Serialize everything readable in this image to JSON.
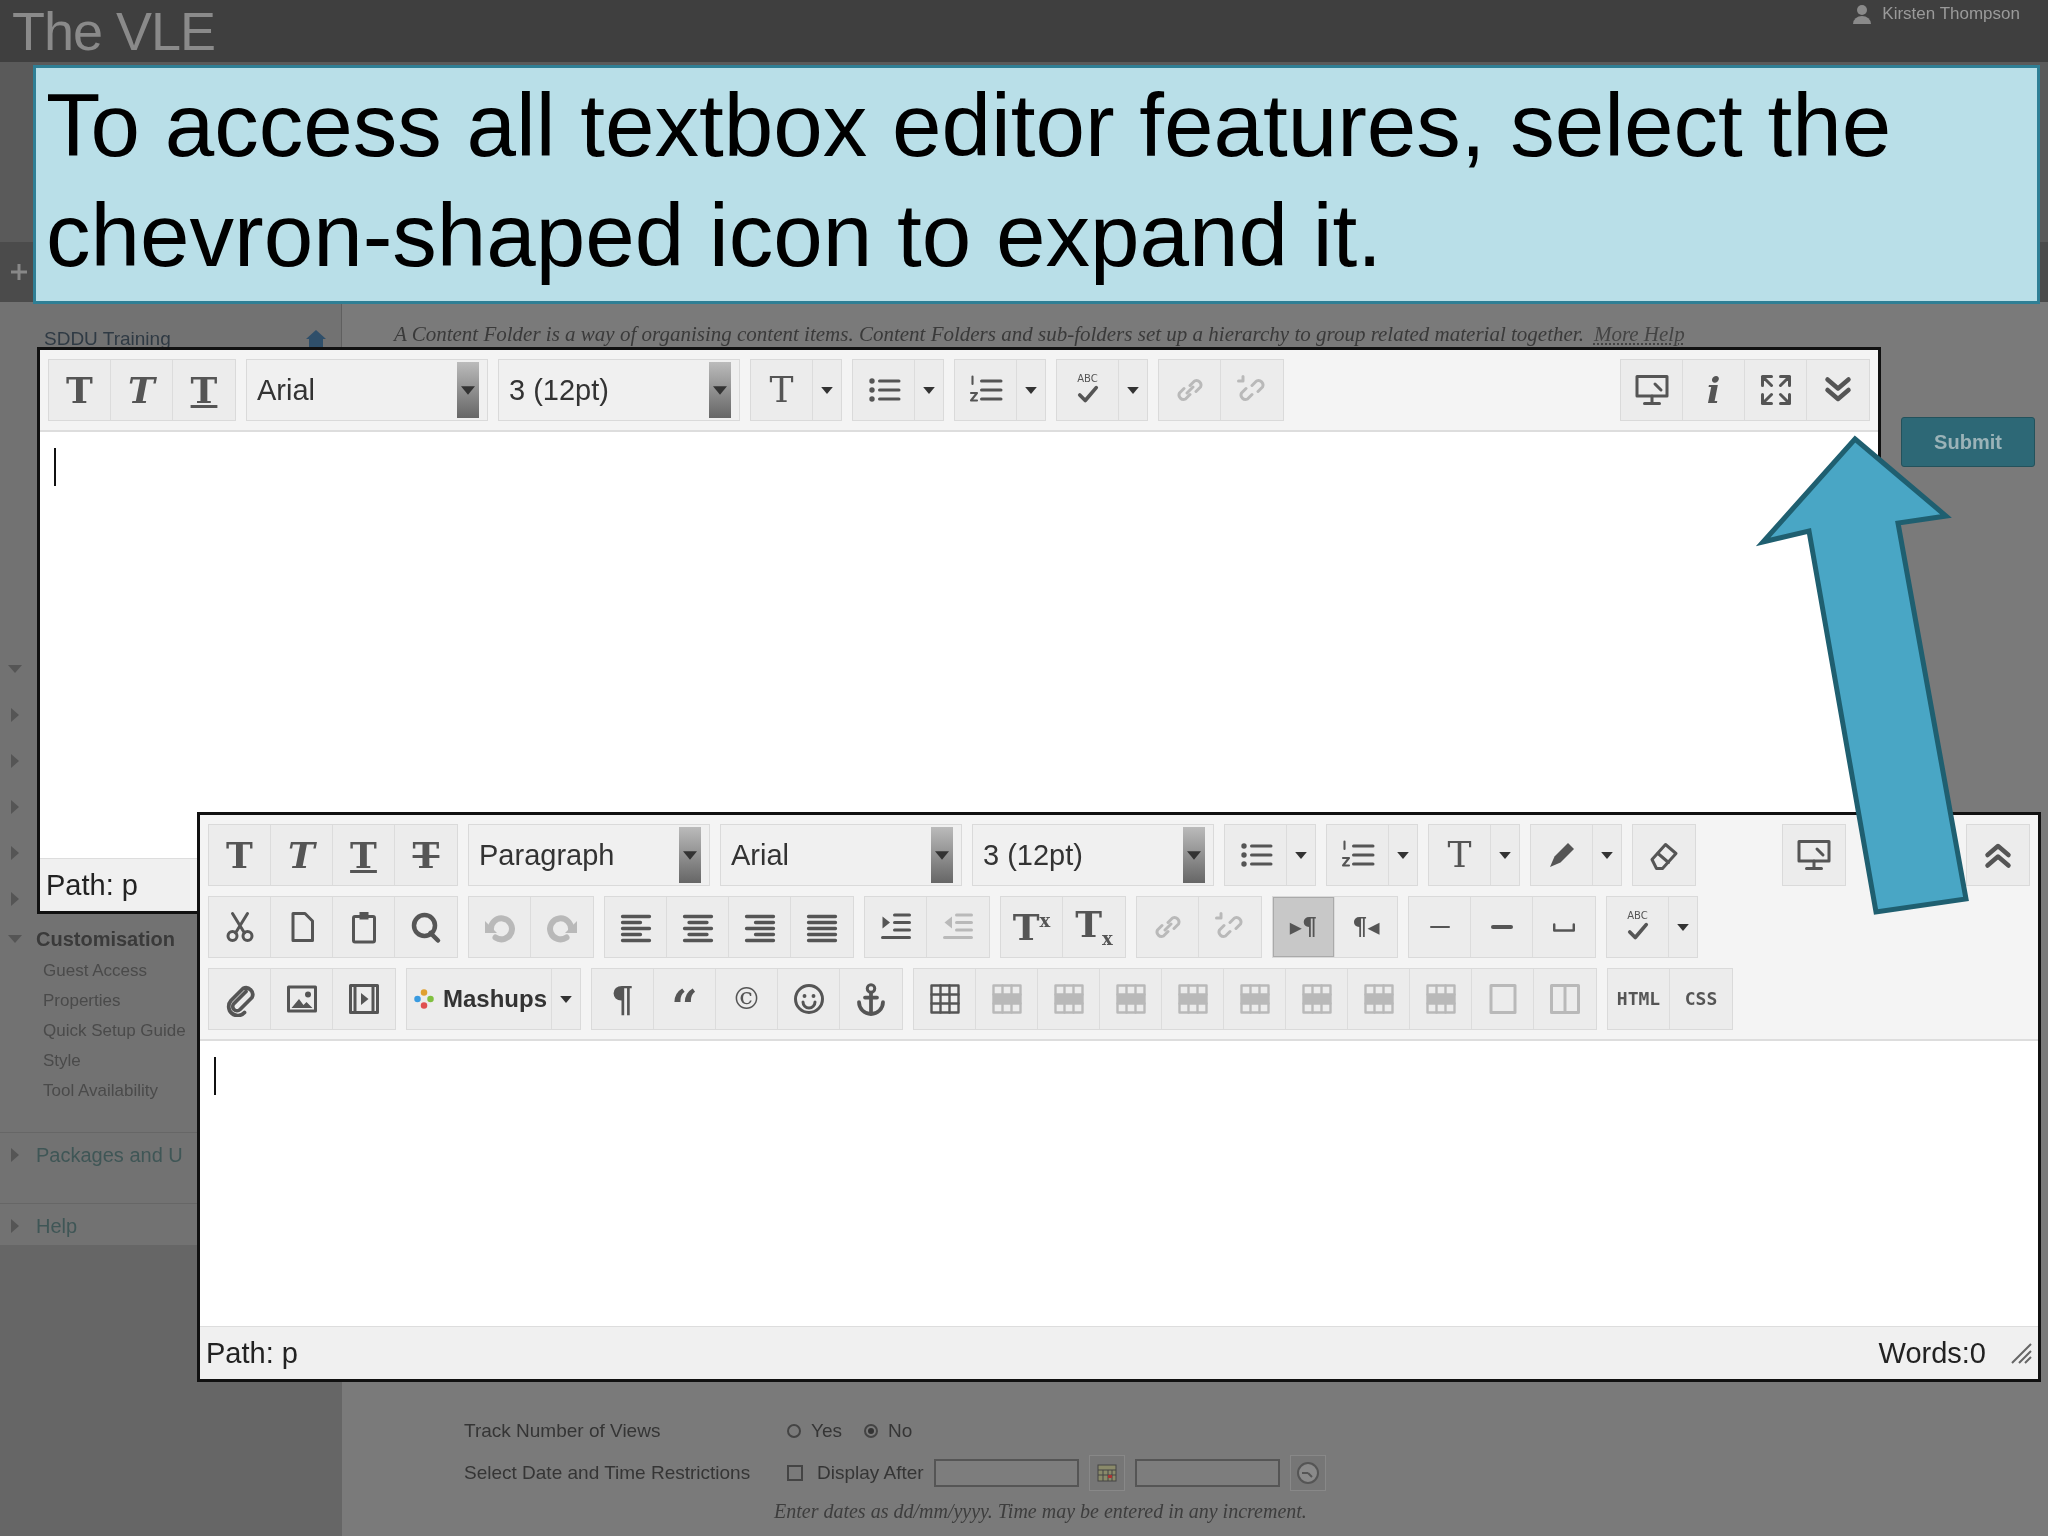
{
  "header": {
    "logo": "The VLE",
    "user": "Kirsten Thompson"
  },
  "callout": {
    "text": "To access all textbox editor features, select the chevron-shaped icon to expand it."
  },
  "sidebar": {
    "course": "SDDU Training",
    "hidden_sections": [
      {
        "expanded": true
      },
      {
        "expanded": false
      },
      {
        "expanded": false
      },
      {
        "expanded": false
      },
      {
        "expanded": false
      },
      {
        "expanded": false
      }
    ],
    "sections": [
      {
        "label": "Customisation",
        "expanded": true,
        "children": [
          {
            "label": "Guest Access"
          },
          {
            "label": "Properties"
          },
          {
            "label": "Quick Setup Guide"
          },
          {
            "label": "Style"
          },
          {
            "label": "Tool Availability"
          }
        ]
      },
      {
        "label": "Packages and U",
        "expanded": false
      },
      {
        "label": "Help",
        "expanded": false
      }
    ]
  },
  "content": {
    "description": "A Content Folder is a way of organising content items. Content Folders and sub-folders set up a hierarchy to group related material together.",
    "help_link": "More Help",
    "submit": "Submit"
  },
  "editor_collapsed": {
    "toolbar": [
      {
        "left": [
          [
            {
              "kind": "bold",
              "text": "T",
              "disabled": false,
              "pressed": false
            },
            {
              "kind": "italic",
              "text": "T",
              "disabled": false,
              "pressed": false
            },
            {
              "kind": "underline",
              "text": "T",
              "disabled": false,
              "pressed": false
            }
          ],
          [
            {
              "kind": "select",
              "value": "Arial",
              "disabled": false,
              "pressed": false
            }
          ],
          [
            {
              "kind": "select",
              "value": "3 (12pt)",
              "disabled": false,
              "pressed": false
            }
          ],
          [
            {
              "kind": "textcolor",
              "text": "T",
              "dropdown": true,
              "disabled": false,
              "pressed": false
            }
          ],
          [
            {
              "kind": "bullets",
              "dropdown": true,
              "disabled": false,
              "pressed": false
            }
          ],
          [
            {
              "kind": "numbers",
              "dropdown": true,
              "disabled": false,
              "pressed": false
            }
          ],
          [
            {
              "kind": "spell",
              "text": "ABC",
              "dropdown": true,
              "disabled": false,
              "pressed": false
            }
          ],
          [
            {
              "kind": "link",
              "disabled": true,
              "pressed": false
            },
            {
              "kind": "unlink",
              "disabled": true,
              "pressed": false
            }
          ]
        ],
        "right": [
          [
            {
              "kind": "monitor",
              "disabled": false,
              "pressed": false
            },
            {
              "kind": "info",
              "text": "i",
              "disabled": false,
              "pressed": false
            },
            {
              "kind": "fullscreen",
              "disabled": false,
              "pressed": false
            },
            {
              "kind": "expand",
              "disabled": false,
              "pressed": false
            }
          ]
        ]
      }
    ],
    "path": "Path: p"
  },
  "editor_expanded": {
    "toolbar": [
      {
        "left": [
          [
            {
              "kind": "bold",
              "text": "T",
              "disabled": false,
              "pressed": false
            },
            {
              "kind": "italic",
              "text": "T",
              "disabled": false,
              "pressed": false
            },
            {
              "kind": "underline",
              "text": "T",
              "disabled": false,
              "pressed": false
            },
            {
              "kind": "strike",
              "text": "T",
              "disabled": false,
              "pressed": false
            }
          ],
          [
            {
              "kind": "select",
              "value": "Paragraph",
              "disabled": false,
              "pressed": false
            }
          ],
          [
            {
              "kind": "select",
              "value": "Arial",
              "disabled": false,
              "pressed": false
            }
          ],
          [
            {
              "kind": "select",
              "value": "3 (12pt)",
              "disabled": false,
              "pressed": false
            }
          ],
          [
            {
              "kind": "bullets",
              "dropdown": true,
              "disabled": false,
              "pressed": false
            }
          ],
          [
            {
              "kind": "numbers",
              "dropdown": true,
              "disabled": false,
              "pressed": false
            }
          ],
          [
            {
              "kind": "textcolor",
              "text": "T",
              "dropdown": true,
              "disabled": false,
              "pressed": false
            }
          ],
          [
            {
              "kind": "highlight",
              "dropdown": true,
              "disabled": false,
              "pressed": false
            }
          ],
          [
            {
              "kind": "eraser",
              "disabled": false,
              "pressed": false
            }
          ]
        ],
        "right": [
          [
            {
              "kind": "monitor",
              "disabled": false,
              "pressed": false
            }
          ],
          [
            {
              "kind": "collapse",
              "disabled": false,
              "pressed": false
            }
          ]
        ]
      },
      {
        "left": [
          [
            {
              "kind": "cut",
              "disabled": false,
              "pressed": false
            },
            {
              "kind": "page",
              "disabled": false,
              "pressed": false
            },
            {
              "kind": "paste",
              "disabled": false,
              "pressed": false
            },
            {
              "kind": "search",
              "disabled": false,
              "pressed": false
            }
          ],
          [
            {
              "kind": "undo",
              "disabled": true,
              "pressed": false
            },
            {
              "kind": "redo",
              "disabled": true,
              "pressed": false
            }
          ],
          [
            {
              "kind": "align-left",
              "disabled": false,
              "pressed": false
            },
            {
              "kind": "align-center",
              "disabled": false,
              "pressed": false
            },
            {
              "kind": "align-right",
              "disabled": false,
              "pressed": false
            },
            {
              "kind": "justify",
              "disabled": false,
              "pressed": false
            }
          ],
          [
            {
              "kind": "indent",
              "disabled": false,
              "pressed": false
            },
            {
              "kind": "outdent",
              "disabled": true,
              "pressed": false
            }
          ],
          [
            {
              "kind": "superscript",
              "text": "T$^{x}$",
              "disabled": false,
              "pressed": false
            },
            {
              "kind": "subscript",
              "text": "T$_{x}$",
              "disabled": false,
              "pressed": false
            }
          ],
          [
            {
              "kind": "link",
              "disabled": true,
              "pressed": false
            },
            {
              "kind": "unlink",
              "disabled": true,
              "pressed": false
            }
          ],
          [
            {
              "kind": "ltr",
              "text": "▸¶",
              "disabled": false,
              "pressed": true
            },
            {
              "kind": "rtl",
              "text": "¶◂",
              "disabled": false,
              "pressed": false
            }
          ],
          [
            {
              "kind": "hr",
              "disabled": false,
              "pressed": false
            },
            {
              "kind": "thick",
              "disabled": false,
              "pressed": false
            },
            {
              "kind": "space",
              "disabled": false,
              "pressed": false
            }
          ],
          [
            {
              "kind": "spell",
              "text": "ABC",
              "dropdown": true,
              "disabled": false,
              "pressed": false
            }
          ]
        ]
      },
      {
        "left": [
          [
            {
              "kind": "attach",
              "disabled": false,
              "pressed": false
            },
            {
              "kind": "image",
              "disabled": false,
              "pressed": false
            },
            {
              "kind": "media",
              "disabled": false,
              "pressed": false
            }
          ],
          [
            {
              "kind": "mashups",
              "label": "Mashups",
              "dropdown": true,
              "disabled": false,
              "pressed": false
            }
          ],
          [
            {
              "kind": "pilcrow",
              "text": "¶",
              "disabled": false,
              "pressed": false
            },
            {
              "kind": "quote",
              "text": "“",
              "disabled": false,
              "pressed": false
            },
            {
              "kind": "copyright",
              "text": "©",
              "disabled": false,
              "pressed": false
            },
            {
              "kind": "smiley",
              "disabled": false,
              "pressed": false
            },
            {
              "kind": "anchor",
              "disabled": false,
              "pressed": false
            }
          ],
          [
            {
              "kind": "table",
              "disabled": false,
              "pressed": false
            },
            {
              "kind": "table-edit",
              "disabled": true,
              "pressed": false
            },
            {
              "kind": "table-edit",
              "disabled": true,
              "pressed": false
            },
            {
              "kind": "table-edit",
              "disabled": true,
              "pressed": false
            },
            {
              "kind": "table-edit",
              "disabled": true,
              "pressed": false
            },
            {
              "kind": "table-edit",
              "disabled": true,
              "pressed": false
            },
            {
              "kind": "table-edit",
              "disabled": true,
              "pressed": false
            },
            {
              "kind": "table-edit",
              "disabled": true,
              "pressed": false
            },
            {
              "kind": "table-edit",
              "disabled": true,
              "pressed": false
            },
            {
              "kind": "box",
              "disabled": true,
              "pressed": false
            },
            {
              "kind": "columns",
              "disabled": true,
              "pressed": false
            }
          ],
          [
            {
              "kind": "html",
              "text": "HTML",
              "disabled": false,
              "pressed": false
            },
            {
              "kind": "css",
              "text": "CSS",
              "disabled": false,
              "pressed": false
            }
          ]
        ]
      }
    ],
    "path": "Path: p",
    "words": "Words:0"
  },
  "form": {
    "track_views": {
      "label": "Track Number of Views",
      "options": [
        {
          "label": "Yes",
          "selected": false
        },
        {
          "label": "No",
          "selected": true
        }
      ]
    },
    "date_restrictions": {
      "label": "Select Date and Time Restrictions",
      "display_after": {
        "label": "Display After",
        "checked": false
      },
      "hint": "Enter dates as dd/mm/yyyy. Time may be entered in any increment."
    }
  }
}
